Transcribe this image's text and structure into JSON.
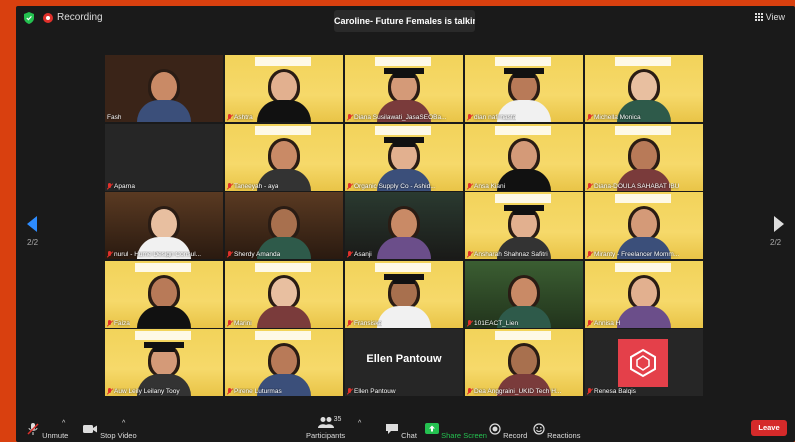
{
  "top": {
    "recording_label": "Recording",
    "talking_label": "Caroline- Future Females is talking...",
    "view_label": "View"
  },
  "nav": {
    "left_page": "2/2",
    "right_page": "2/2"
  },
  "participants": [
    {
      "name": "Fash",
      "muted": false,
      "bg": "dark"
    },
    {
      "name": "Ashtra",
      "muted": true,
      "bg": "yellow"
    },
    {
      "name": "Diana Susilawati_JasaSEOBa...",
      "muted": true,
      "bg": "yellow",
      "cap": true
    },
    {
      "name": "dian nafi hasfa",
      "muted": true,
      "bg": "yellow",
      "cap": true
    },
    {
      "name": "Michella Monica",
      "muted": true,
      "bg": "yellow"
    },
    {
      "name": "Aparna",
      "muted": true,
      "bg": "none"
    },
    {
      "name": "Taneeyah - aya",
      "muted": true,
      "bg": "yellow"
    },
    {
      "name": "Organic Supply Co - Ashid...",
      "muted": true,
      "bg": "yellow",
      "cap": true
    },
    {
      "name": "Ansa Kiani",
      "muted": true,
      "bg": "yellow"
    },
    {
      "name": "Diana-DOULA SAHABAT IBU",
      "muted": true,
      "bg": "yellow"
    },
    {
      "name": "nurul - Hume Design Consul...",
      "muted": true,
      "bg": "room"
    },
    {
      "name": "Sherdy Amanda",
      "muted": true,
      "bg": "room"
    },
    {
      "name": "Asanji",
      "muted": true,
      "bg": "room2"
    },
    {
      "name": "Ansharah Shahnaz Safitri",
      "muted": true,
      "bg": "yellow",
      "cap": true
    },
    {
      "name": "Miranty - Freelancer Momm...",
      "muted": true,
      "bg": "yellow"
    },
    {
      "name": "Faiza",
      "muted": true,
      "bg": "yellow"
    },
    {
      "name": "Marini",
      "muted": true,
      "bg": "yellow"
    },
    {
      "name": "Fransiska",
      "muted": true,
      "bg": "yellow",
      "cap": true
    },
    {
      "name": "101EACT_Lien",
      "muted": true,
      "bg": "green"
    },
    {
      "name": "Annisa H",
      "muted": true,
      "bg": "yellow"
    },
    {
      "name": "Auw Leily Leilany Tooy",
      "muted": true,
      "bg": "yellow",
      "cap": true
    },
    {
      "name": "Pirene Luturmas",
      "muted": true,
      "bg": "yellow"
    },
    {
      "name": "Ellen Pantouw",
      "muted": true,
      "bg": "name",
      "display": "Ellen Pantouw"
    },
    {
      "name": "Dea Anggraini_UKID Tech H...",
      "muted": true,
      "bg": "yellow"
    },
    {
      "name": "Renesa Balqis",
      "muted": true,
      "bg": "logo"
    }
  ],
  "controls": {
    "unmute": "Unmute",
    "stop_video": "Stop Video",
    "participants": "Participants",
    "participants_count": "35",
    "chat": "Chat",
    "share_screen": "Share Screen",
    "record": "Record",
    "reactions": "Reactions",
    "leave": "Leave"
  },
  "colors": {
    "accent": "#2d8cff",
    "share_green": "#24c150",
    "leave_red": "#d52a2a",
    "muted_red": "#e0302b",
    "frame_orange": "#d9400f"
  }
}
